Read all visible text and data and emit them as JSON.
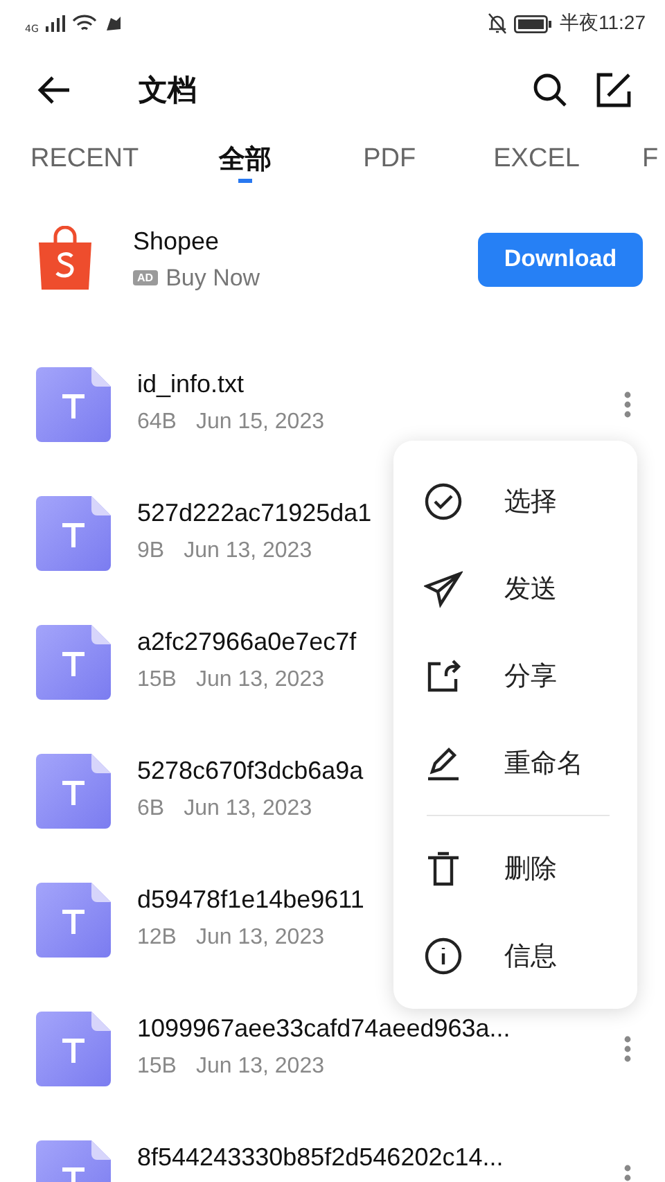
{
  "status_bar": {
    "network": "4G",
    "time": "半夜11:27"
  },
  "header": {
    "title": "文档"
  },
  "tabs": [
    {
      "label": "RECENT",
      "selected": false
    },
    {
      "label": "全部",
      "selected": true
    },
    {
      "label": "PDF",
      "selected": false
    },
    {
      "label": "EXCEL",
      "selected": false
    },
    {
      "label": "F",
      "selected": false
    }
  ],
  "ad": {
    "name": "Shopee",
    "badge": "AD",
    "tagline": "Buy Now",
    "button": "Download"
  },
  "files": [
    {
      "name": "id_info.txt",
      "size": "64B",
      "date": "Jun 15, 2023",
      "covered": false
    },
    {
      "name": "527d222ac71925da1",
      "size": "9B",
      "date": "Jun 13, 2023",
      "covered": true
    },
    {
      "name": "a2fc27966a0e7ec7f",
      "size": "15B",
      "date": "Jun 13, 2023",
      "covered": true
    },
    {
      "name": "5278c670f3dcb6a9a",
      "size": "6B",
      "date": "Jun 13, 2023",
      "covered": true
    },
    {
      "name": "d59478f1e14be9611",
      "size": "12B",
      "date": "Jun 13, 2023",
      "covered": true
    },
    {
      "name": "1099967aee33cafd74aeed963a...",
      "size": "15B",
      "date": "Jun 13, 2023",
      "covered": false
    },
    {
      "name": "8f544243330b85f2d546202c14...",
      "covered": false
    }
  ],
  "context_menu": [
    {
      "kind": "select",
      "label": "选择"
    },
    {
      "kind": "send",
      "label": "发送"
    },
    {
      "kind": "share",
      "label": "分享"
    },
    {
      "kind": "rename",
      "label": "重命名"
    },
    {
      "kind": "delete",
      "label": "删除"
    },
    {
      "kind": "info",
      "label": "信息"
    }
  ]
}
